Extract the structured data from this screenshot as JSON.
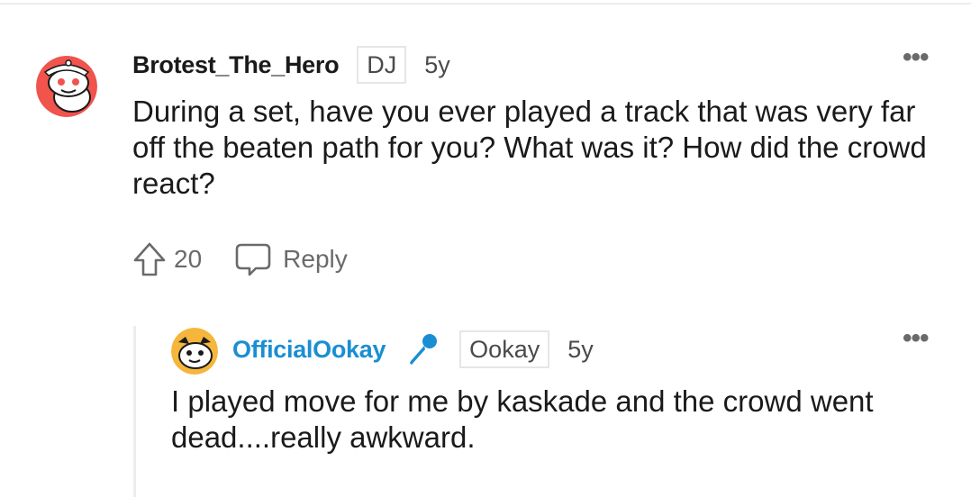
{
  "top_comment": {
    "username": "Brotest_The_Hero",
    "flair": "DJ",
    "age": "5y",
    "more_label": "•••",
    "body": "During a set, have you ever played a track that was very far off the beaten path for you? What was it? How did the crowd react?",
    "upvote_icon": "upvote-arrow-icon",
    "vote_count": "20",
    "reply_icon": "speech-bubble-icon",
    "reply_label": "Reply",
    "avatar_icon": "snoo-avatar-icon"
  },
  "reply_comment": {
    "username": "OfficialOokay",
    "badge_icon": "microphone-icon",
    "flair": "Ookay",
    "age": "5y",
    "more_label": "•••",
    "body": "I played move for me by kaskade and the crowd went dead....really awkward.",
    "avatar_icon": "snoo-avatar-icon"
  },
  "colors": {
    "accent_username": "#1a8ed3",
    "avatar_bg_top": "#f0544c",
    "avatar_bg_reply": "#f5b63b"
  }
}
